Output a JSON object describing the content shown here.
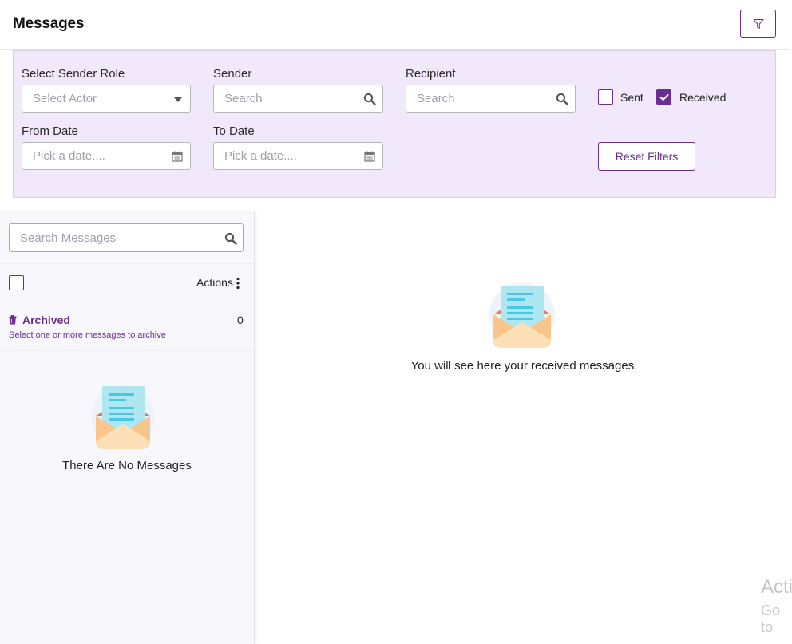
{
  "header": {
    "title": "Messages"
  },
  "filters": {
    "sender_role": {
      "label": "Select Sender Role",
      "placeholder": "Select Actor"
    },
    "sender": {
      "label": "Sender",
      "placeholder": "Search"
    },
    "recipient": {
      "label": "Recipient",
      "placeholder": "Search"
    },
    "sent": {
      "label": "Sent",
      "checked": false
    },
    "received": {
      "label": "Received",
      "checked": true
    },
    "from_date": {
      "label": "From Date",
      "placeholder": "Pick a date...."
    },
    "to_date": {
      "label": "To Date",
      "placeholder": "Pick a date...."
    },
    "reset_label": "Reset Filters"
  },
  "sidebar": {
    "search_placeholder": "Search Messages",
    "actions_label": "Actions",
    "archived": {
      "title": "Archived",
      "hint": "Select one or more messages to archive",
      "count": "0"
    },
    "empty_text": "There Are No Messages"
  },
  "main": {
    "empty_text": "You will see here your received messages."
  },
  "watermark": {
    "line1": "Acti",
    "line2": "Go to"
  },
  "colors": {
    "accent": "#6a2c91",
    "filter_panel_bg": "#f1e9fb"
  }
}
